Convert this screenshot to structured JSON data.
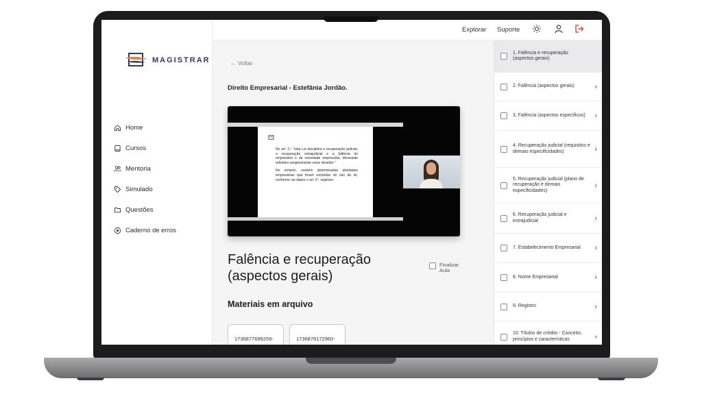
{
  "topbar": {
    "explore": "Explorar",
    "support": "Suporte"
  },
  "logo": {
    "text": "MAGISTRAR"
  },
  "sidebar": {
    "items": [
      {
        "label": "Home",
        "icon": "home-icon"
      },
      {
        "label": "Cursos",
        "icon": "book-icon"
      },
      {
        "label": "Mentoria",
        "icon": "users-icon"
      },
      {
        "label": "Simulado",
        "icon": "tag-icon"
      },
      {
        "label": "Questões",
        "icon": "folder-icon"
      },
      {
        "label": "Caderno de erros",
        "icon": "target-icon"
      }
    ]
  },
  "main": {
    "back": "← Voltar",
    "course_title": "Direito Empresarial - Estefânia Jordão.",
    "video": {
      "slide_p1": "No art. 1º, \"esta Lei disciplina a recuperação judicial, a recuperação extrajudicial e a falência do empresário e da sociedade empresária, doravante referidos simplesmente como devedor.\"",
      "slide_p2": "No entanto, existem determinadas atividades empresárias que foram excluídas do uso da lei, conforme vai dispor o art. 2º, vejamos:"
    },
    "lesson_title": "Falência e recuperação (aspectos gerais)",
    "finish_label_1": "Finalizar",
    "finish_label_2": "Aula",
    "materials_title": "Materiais em arquivo",
    "files": [
      "1736877699259-",
      "1736878172960-"
    ]
  },
  "lessons": [
    {
      "label": "1. Falência e recuperação (aspectos gerais)",
      "active": true
    },
    {
      "label": "2. Falência (aspectos gerais)"
    },
    {
      "label": "3. Falência (aspectos específicos)"
    },
    {
      "label": "4. Recuperação judicial (requisitos e demais especificidades)"
    },
    {
      "label": "5. Recuperação judicial (plano de recuperação e demais especificidades)"
    },
    {
      "label": "6. Recuperação judicial e extrajudicial"
    },
    {
      "label": "7. Estabelecimento Empresarial"
    },
    {
      "label": "8. Nome Empresarial"
    },
    {
      "label": "9. Registro"
    },
    {
      "label": "10. Títulos de crédito - Conceito, princípios e características"
    }
  ],
  "colors": {
    "accent": "#5a6b93",
    "logo": "#2d3a5e",
    "logout": "#e0312b"
  }
}
